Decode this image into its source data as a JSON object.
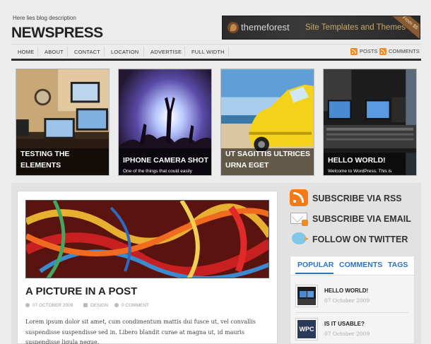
{
  "header": {
    "description": "Here lies blog description",
    "logo": "NEWSPRESS",
    "banner": {
      "brand": "themeforest",
      "tagline": "Site Templates and Themes",
      "ribbon": "From $5"
    }
  },
  "nav": {
    "items": [
      "HOME",
      "ABOUT",
      "CONTACT",
      "LOCATION",
      "ADVERTISE",
      "FULL WIDTH"
    ],
    "feeds": [
      "POSTS",
      "COMMENTS"
    ]
  },
  "featured": [
    {
      "title": "TESTING THE ELEMENTS",
      "excerpt": ""
    },
    {
      "title": "IPHONE CAMERA SHOT",
      "excerpt": "One of the things that could easily"
    },
    {
      "title": "UT SAGITTIS ULTRICES URNA EGET",
      "excerpt": ""
    },
    {
      "title": "HELLO WORLD!",
      "excerpt": "Welcome to WordPress. This is"
    }
  ],
  "post": {
    "title": "A PICTURE IN A POST",
    "date": "07 OCTOBER 2009",
    "category": "DESIGN",
    "comments": "0 COMMENT",
    "body": "Lorem ipsum dolor sit amet, cum condimentum mattis dui fusce ut, vel convallis suspendisse suspendisse sed in. Libero blandit curae at magna ut, id mauris suspendisse ligula neque."
  },
  "sidebar": {
    "subscribe_rss": "SUBSCRIBE VIA RSS",
    "subscribe_email": "SUBSCRIBE VIA EMAIL",
    "follow_twitter": "FOLLOW ON TWITTER",
    "tabs": [
      "POPULAR",
      "COMMENTS",
      "TAGS"
    ],
    "popular": [
      {
        "title": "HELLO WORLD!",
        "date": "07 October 2009",
        "thumb": "monitor"
      },
      {
        "title": "IS IT USABLE?",
        "date": "07 October 2009",
        "thumb": "WPC"
      }
    ]
  },
  "colors": {
    "accent": "#2a72c6",
    "rss": "#f27a18",
    "nav_bar": "#2e2e2e"
  }
}
